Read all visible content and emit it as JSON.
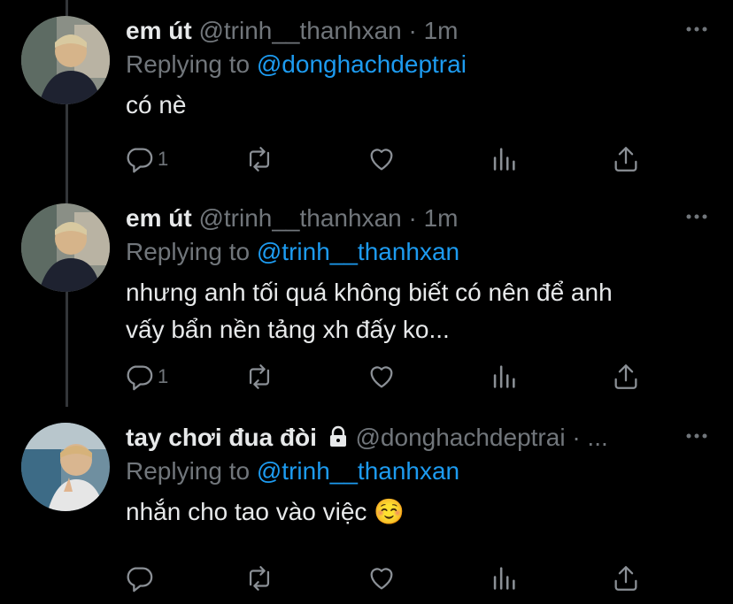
{
  "tweets": [
    {
      "name": "em út",
      "handle": "@trinh__thanhxan",
      "time": "1m",
      "reply_prefix": "Replying to",
      "reply_to": "@donghachdeptrai",
      "text": "có nè",
      "reply_count": "1",
      "avatar_icon": "avatar-photo"
    },
    {
      "name": "em út",
      "handle": "@trinh__thanhxan",
      "time": "1m",
      "reply_prefix": "Replying to",
      "reply_to": "@trinh__thanhxan",
      "text_line1": "nhưng anh tối quá không biết có nên để anh",
      "text_line2": "vấy bẩn nền tảng xh đấy ko...",
      "reply_count": "1",
      "avatar_icon": "avatar-photo"
    },
    {
      "name": "tay chơi đua đòi",
      "handle": "@donghachdeptrai · ...",
      "reply_prefix": "Replying to",
      "reply_to": "@trinh__thanhxan",
      "text": "nhắn cho tao vào việc ☺️",
      "reply_count": "",
      "avatar_icon": "avatar-photo",
      "locked": true
    }
  ],
  "icons": [
    "reply-icon",
    "retweet-icon",
    "like-icon",
    "analytics-icon",
    "share-icon",
    "more-icon",
    "lock-icon"
  ],
  "colors": {
    "background": "#000000",
    "text": "#e7e9ea",
    "secondary": "#71767b",
    "link": "#1d9bf0",
    "thread_line": "#333639"
  }
}
